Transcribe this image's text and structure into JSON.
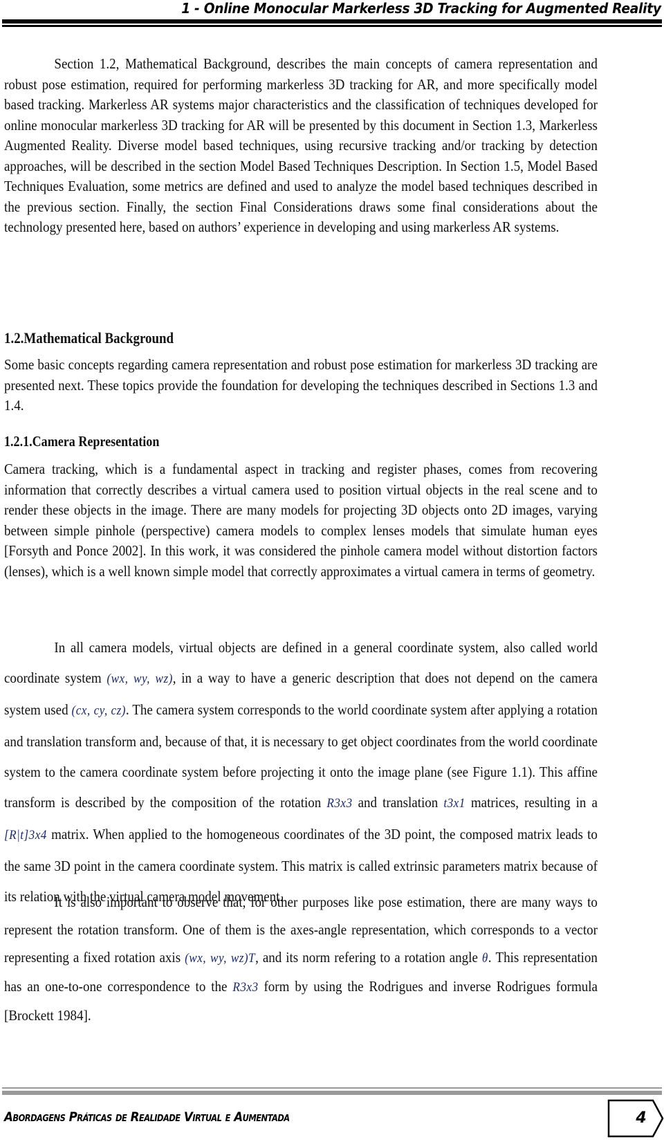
{
  "header": {
    "running_title": "1 - Online Monocular Markerless 3D Tracking for Augmented Reality"
  },
  "intro": {
    "paragraph": "Section 1.2, Mathematical Background, describes the main concepts of camera representation and robust pose estimation, required for performing markerless 3D tracking for AR, and more specifically model based tracking. Markerless AR systems major characteristics and the classification of techniques developed for online monocular markerless 3D tracking for AR will be presented by this document in Section 1.3, Markerless Augmented Reality. Diverse model based techniques, using recursive tracking and/or tracking by detection approaches, will be described in the section Model Based Techniques Description. In Section 1.5, Model Based Techniques Evaluation, some metrics are defined and used to analyze the model based techniques described in the previous section. Finally, the section Final Considerations draws some final considerations about the technology presented here, based on authors’ experience in developing and using markerless AR systems."
  },
  "section_1_2": {
    "heading": "1.2.Mathematical Background",
    "paragraph": "Some basic concepts regarding camera representation and robust pose estimation for markerless 3D tracking are presented next. These topics provide the foundation for developing the techniques described in Sections 1.3 and 1.4."
  },
  "section_1_2_1": {
    "heading": "1.2.1.Camera Representation",
    "paragraph_1": "Camera tracking, which is a fundamental aspect in tracking and register phases, comes from recovering information that correctly describes a virtual camera used to position virtual objects in the real scene and to render these objects in the image. There are many models for projecting 3D objects onto 2D images, varying between simple pinhole (perspective) camera models to complex lenses models that simulate human eyes [Forsyth and Ponce 2002]. In this work, it was considered the pinhole camera model without distortion factors (lenses), which is a well known simple model that correctly approximates a virtual camera in terms of geometry.",
    "paragraph_2": {
      "part_1": "In all camera models, virtual objects are defined in a general coordinate system, also called world coordinate system ",
      "math_world": "(wx, wy, wz)",
      "part_2": ", in a way to have a generic description that does not depend on the camera system used ",
      "math_camera": "(cx, cy, cz)",
      "part_3": ". The camera system corresponds to the world coordinate system after applying a rotation and translation transform and, because of that, it is necessary to get object coordinates from the world coordinate system to the camera coordinate system before projecting it onto the image plane (see Figure 1.1). This affine transform is described by the composition of the rotation ",
      "math_rotation": "R3x3",
      "part_4": " and translation ",
      "math_translation": "t3x1",
      "part_5": " matrices, resulting in a ",
      "math_rt": "[R|t]3x4",
      "part_6": " matrix. When applied to the homogeneous coordinates of the 3D point, the composed matrix leads to the same 3D point in the camera coordinate system. This matrix is called extrinsic parameters matrix because of its relation with the virtual camera model movement."
    },
    "paragraph_3": {
      "part_1": "It is also important to observe that, for other purposes like pose estimation, there are many ways to represent the rotation transform. One of them is the axes-angle representation, which corresponds to a vector representing a fixed rotation axis ",
      "math_axis": "(wx, wy, wz)T",
      "part_2": ", and its norm refering to a rotation angle ",
      "math_angle": "θ",
      "part_3": ". This representation has an one-to-one correspondence to the ",
      "math_rotation": "R3x3",
      "part_4": " form by using the Rodrigues and inverse Rodrigues formula [Brockett 1984]."
    }
  },
  "footer": {
    "book_title": "Abordagens Práticas de Realidade Virtual e Aumentada",
    "page_number": "4"
  }
}
